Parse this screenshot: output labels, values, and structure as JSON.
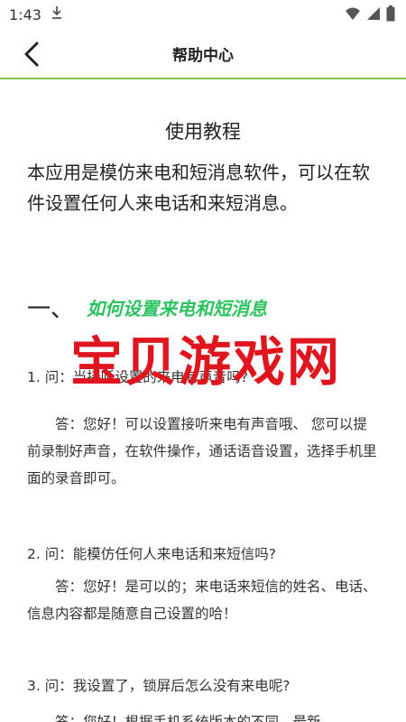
{
  "status_bar": {
    "time": "1:43",
    "icons": [
      "download-icon",
      "wifi-icon",
      "signal-icon",
      "battery-icon"
    ]
  },
  "app_bar": {
    "title": "帮助中心",
    "back_icon": "back-arrow-icon"
  },
  "content": {
    "tutorial_title": "使用教程",
    "intro": "本应用是模仿来电和短消息软件，可以在软件设置任何人来电话和来短消息。",
    "section": {
      "number": "一、",
      "heading": "如何设置来电和短消息"
    },
    "qa": [
      {
        "question": "1. 问：当接听设置的来电有声音吗?",
        "answer": "答：您好！可以设置接听来电有声音哦、 您可以提前录制好声音，在软件操作，通话语音设置，选择手机里面的录音即可。"
      },
      {
        "question": "2. 问：能模仿任何人来电话和来短信吗?",
        "answer": "答：您好！是可以的；来电话来短信的姓名、电话、信息内容都是随意自己设置的哈！"
      },
      {
        "question": "3. 问：我设置了，锁屏后怎么没有来电呢?",
        "answer": "答：您好！根据手机系统版本的不同，最新"
      }
    ]
  },
  "watermark": "宝贝游戏网",
  "colors": {
    "accent_green": "#8bc34a",
    "heading_green": "#2bc35f",
    "watermark_red": "#e0161f"
  }
}
